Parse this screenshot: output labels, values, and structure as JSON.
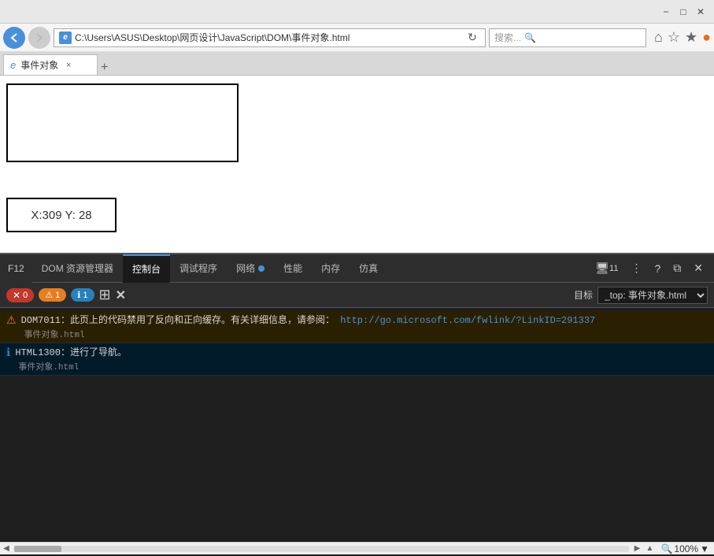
{
  "titlebar": {
    "minimize": "−",
    "maximize": "□",
    "close": "✕"
  },
  "navbar": {
    "back_icon": "◀",
    "forward_icon": "▶",
    "address_icon": "e",
    "address_text": "C:\\Users\\ASUS\\Desktop\\网页设计\\JavaScript\\DOM\\事件对象.html",
    "reload_icon": "↻",
    "search_placeholder": "搜索...",
    "search_icon": "🔍",
    "home_icon": "⌂",
    "star_icon": "☆",
    "star2_icon": "★",
    "user_icon": "👤"
  },
  "tabbar": {
    "tab_icon": "e",
    "tab_label": "事件对象",
    "tab_close": "×",
    "new_tab": "+"
  },
  "content": {
    "coord_text": "X:309 Y: 28"
  },
  "devtools": {
    "f12_label": "F12",
    "tabs": [
      {
        "id": "dom",
        "label": "DOM 资源管理器",
        "active": false
      },
      {
        "id": "console",
        "label": "控制台",
        "active": true
      },
      {
        "id": "debugger",
        "label": "调试程序",
        "active": false
      },
      {
        "id": "network",
        "label": "网络",
        "active": false
      },
      {
        "id": "perf",
        "label": "性能",
        "active": false
      },
      {
        "id": "memory",
        "label": "内存",
        "active": false
      },
      {
        "id": "emulation",
        "label": "仿真",
        "active": false
      }
    ],
    "right_icons": {
      "monitor": "🖥",
      "count": "11",
      "dots": "⋮",
      "help": "?",
      "undock": "⧉",
      "close": "✕"
    },
    "console_toolbar": {
      "errors": {
        "count": "0",
        "label": "0"
      },
      "warnings": {
        "count": "1",
        "label": "1"
      },
      "info": {
        "count": "1",
        "label": "1"
      },
      "filter_icon": "⊞",
      "clear_icon": "✕",
      "target_label": "目标",
      "target_value": "_top: 事件对象.html"
    },
    "console_rows": [
      {
        "type": "warn",
        "icon": "⚠",
        "text": "DOM7011：此页上的代码禁用了反向和正向缓存。有关详细信息，请参阅：",
        "link_text": "http://go.microsoft.com/fwlink/?LinkID=291337",
        "link_url": "http://go.microsoft.com/fwlink/?LinkID=291337",
        "file": "事件对象.html"
      },
      {
        "type": "info",
        "icon": "ℹ",
        "text": "HTML1300：进行了导航。",
        "file": "事件对象.html"
      }
    ]
  },
  "bottombar": {
    "zoom_label": "100%",
    "zoom_icon": "🔍"
  }
}
